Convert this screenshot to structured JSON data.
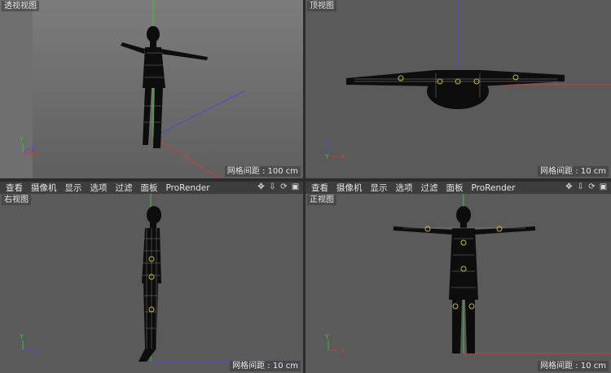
{
  "viewports": {
    "perspective": {
      "label": "透视视图",
      "grid": "网格间距 : 100 cm"
    },
    "top": {
      "label": "顶视图",
      "grid": "网格间距 : 10 cm"
    },
    "right": {
      "label": "右视图",
      "grid": "网格间距 : 10 cm"
    },
    "front": {
      "label": "正视图",
      "grid": "网格间距 : 10 cm"
    }
  },
  "menu": [
    "查看",
    "摄像机",
    "显示",
    "选项",
    "过滤",
    "面板",
    "ProRender"
  ],
  "axes": {
    "x": "X",
    "y": "Y",
    "z": "Z"
  },
  "tool_icons": [
    "move-icon",
    "down-arrow-icon",
    "rotate-icon",
    "maximize-icon"
  ],
  "colors": {
    "x_axis": "#d23a3a",
    "y_axis": "#3fbf3f",
    "z_axis": "#4a4ad6",
    "viewport_bg": "#5a5a5a"
  }
}
